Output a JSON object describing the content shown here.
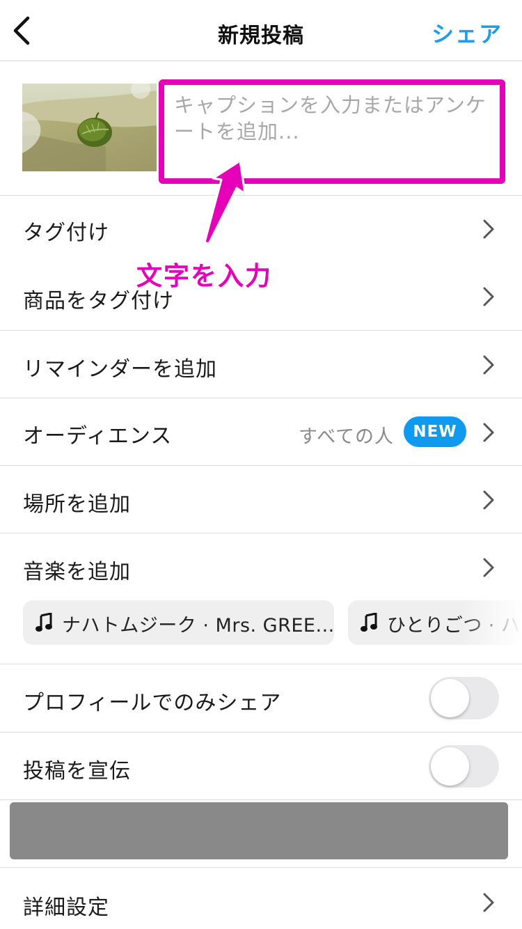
{
  "header": {
    "title": "新規投稿",
    "share_label": "シェア"
  },
  "caption": {
    "placeholder": "キャプションを入力またはアンケートを追加..."
  },
  "menu": {
    "tag": "タグ付け",
    "product_tag": "商品をタグ付け",
    "reminder": "リマインダーを追加",
    "audience": {
      "label": "オーディエンス",
      "value": "すべての人",
      "badge": "NEW"
    },
    "location": "場所を追加",
    "music": "音楽を追加",
    "share_profile_only": "プロフィールでのみシェア",
    "promote": "投稿を宣伝",
    "advanced": "詳細設定"
  },
  "music_suggestions": [
    {
      "text": "ナハトムジーク · Mrs. GREE..."
    },
    {
      "text": "ひとりごつ · ハ"
    }
  ],
  "toggles": {
    "share_profile_only": false,
    "promote": false
  },
  "annotation": {
    "text": "文字を入力"
  },
  "colors": {
    "accent": "#1e9df0",
    "annotation": "#e600b8",
    "badge": "#0f9af0"
  }
}
